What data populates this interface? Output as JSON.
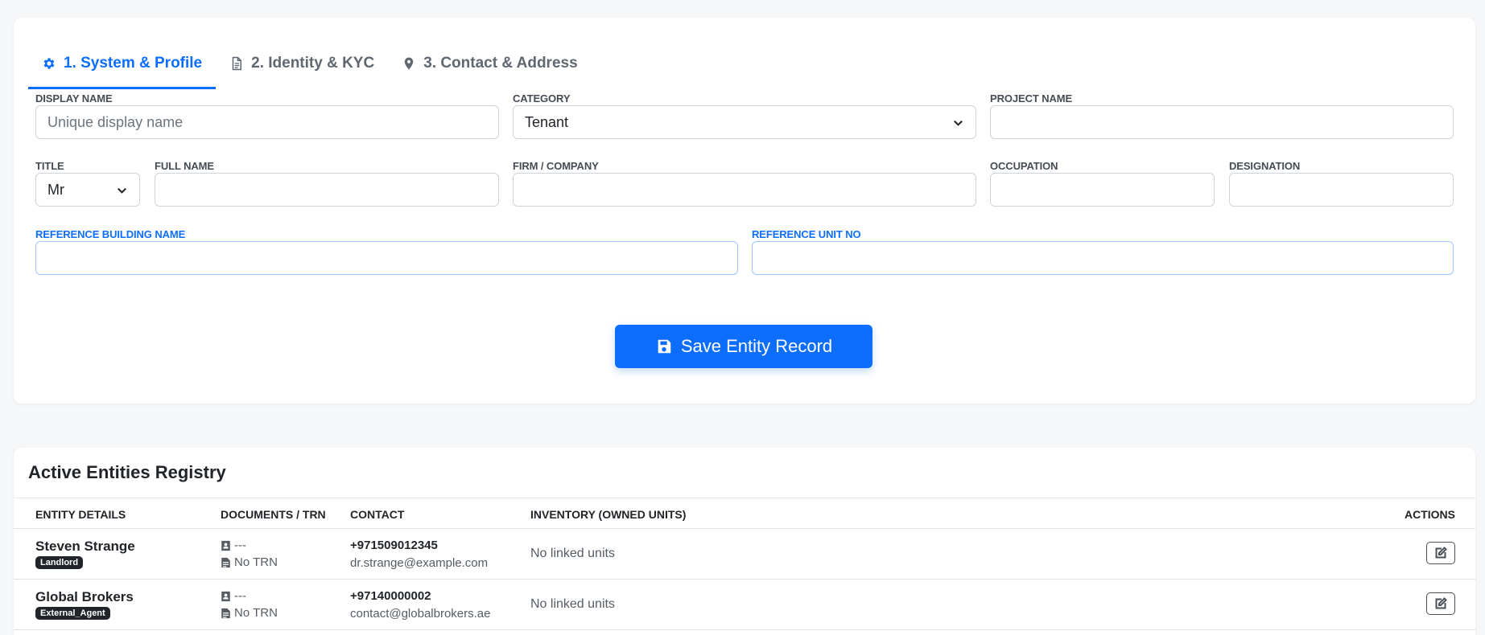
{
  "tabs": [
    {
      "label": "1. System & Profile",
      "icon": "gear-icon",
      "active": true
    },
    {
      "label": "2. Identity & KYC",
      "icon": "document-icon",
      "active": false
    },
    {
      "label": "3. Contact & Address",
      "icon": "map-pin-icon",
      "active": false
    }
  ],
  "form": {
    "display_name": {
      "label": "DISPLAY NAME",
      "placeholder": "Unique display name",
      "value": ""
    },
    "category": {
      "label": "CATEGORY",
      "value": "Tenant"
    },
    "project_name": {
      "label": "PROJECT NAME",
      "value": ""
    },
    "title": {
      "label": "TITLE",
      "value": "Mr"
    },
    "full_name": {
      "label": "FULL NAME",
      "value": ""
    },
    "firm_company": {
      "label": "FIRM / COMPANY",
      "value": ""
    },
    "occupation": {
      "label": "OCCUPATION",
      "value": ""
    },
    "designation": {
      "label": "DESIGNATION",
      "value": ""
    },
    "reference_building_name": {
      "label": "REFERENCE BUILDING NAME",
      "value": ""
    },
    "reference_unit_no": {
      "label": "REFERENCE UNIT NO",
      "value": ""
    },
    "save_label": "Save Entity Record"
  },
  "registry": {
    "title": "Active Entities Registry",
    "columns": [
      "ENTITY DETAILS",
      "DOCUMENTS / TRN",
      "CONTACT",
      "INVENTORY (OWNED UNITS)",
      "ACTIONS"
    ],
    "rows": [
      {
        "name": "Steven Strange",
        "badge": "Landlord",
        "document": "---",
        "trn": "No TRN",
        "phone": "+971509012345",
        "email": "dr.strange@example.com",
        "inventory": "No linked units"
      },
      {
        "name": "Global Brokers",
        "badge": "External_Agent",
        "document": "---",
        "trn": "No TRN",
        "phone": "+97140000002",
        "email": "contact@globalbrokers.ae",
        "inventory": "No linked units"
      }
    ]
  },
  "colors": {
    "accent": "#0d6efd",
    "badge_bg": "#212529",
    "page_bg": "#f6f7f9"
  }
}
